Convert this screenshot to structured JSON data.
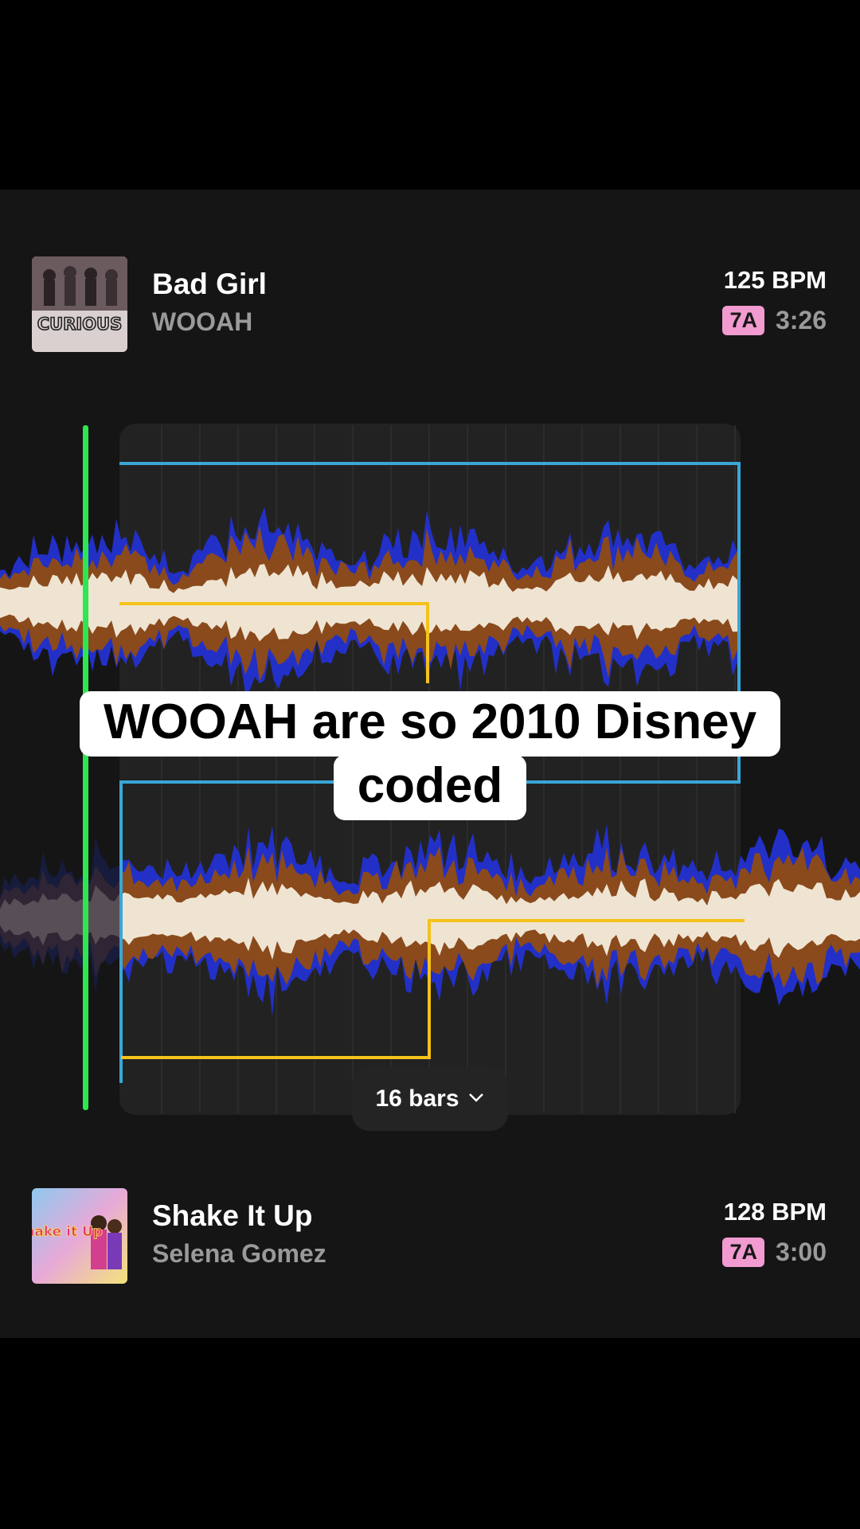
{
  "top_track": {
    "title": "Bad Girl",
    "artist": "WOOAH",
    "bpm": "125 BPM",
    "key": "7A",
    "duration": "3:26",
    "art_text": "CURIOUS"
  },
  "bottom_track": {
    "title": "Shake It Up",
    "artist": "Selena Gomez",
    "bpm": "128 BPM",
    "key": "7A",
    "duration": "3:00",
    "art_text": "Shake it Up"
  },
  "transition": {
    "bars_label": "16 bars",
    "dropdown_icon": "chevron-down-icon"
  },
  "caption": {
    "line1": "WOOAH are so 2010 Disney",
    "line2": "coded"
  },
  "colors": {
    "playhead": "#2ee64f",
    "loop_region": "#3aa6d6",
    "fader_line": "#f5c21a",
    "key_badge": "#f19bd0",
    "wave_outer": "#2230c8",
    "wave_mid": "#8a4a1c",
    "wave_core": "#efe4d2"
  }
}
